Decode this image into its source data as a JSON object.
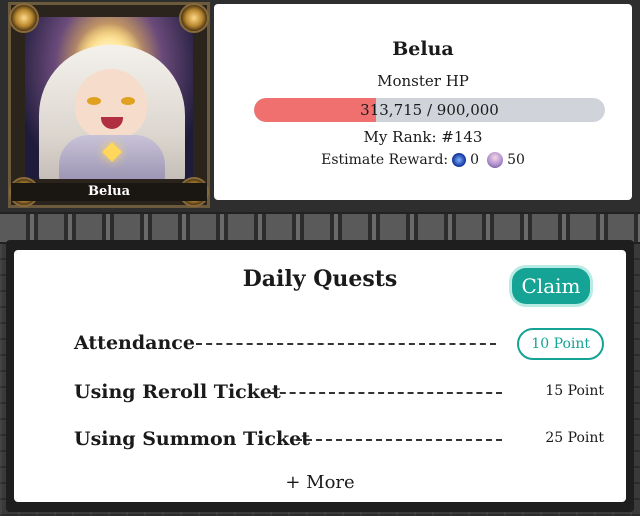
{
  "boss": {
    "portrait_name": "Belua",
    "name": "Belua",
    "hp_label": "Monster HP",
    "hp_current": 313715,
    "hp_max": 900000,
    "hp_text": "313,715 / 900,000",
    "rank_text": "My Rank: #143",
    "reward_label": "Estimate Reward:",
    "reward_coin_value": "0",
    "reward_pet_value": "50"
  },
  "quests": {
    "title": "Daily Quests",
    "claim_label": "Claim",
    "items": [
      {
        "name": "Attendance",
        "points": "10 Point",
        "claimable": true
      },
      {
        "name": "Using Reroll Ticket",
        "points": "15 Point",
        "claimable": false
      },
      {
        "name": "Using Summon Ticket",
        "points": "25 Point",
        "claimable": false
      }
    ],
    "more_label": "+ More"
  },
  "colors": {
    "hp_fill": "#f07070",
    "hp_track": "#d0d3da",
    "accent": "#15a395"
  },
  "icons": {
    "coin": "blue-coin-icon",
    "pet": "pet-token-icon"
  }
}
